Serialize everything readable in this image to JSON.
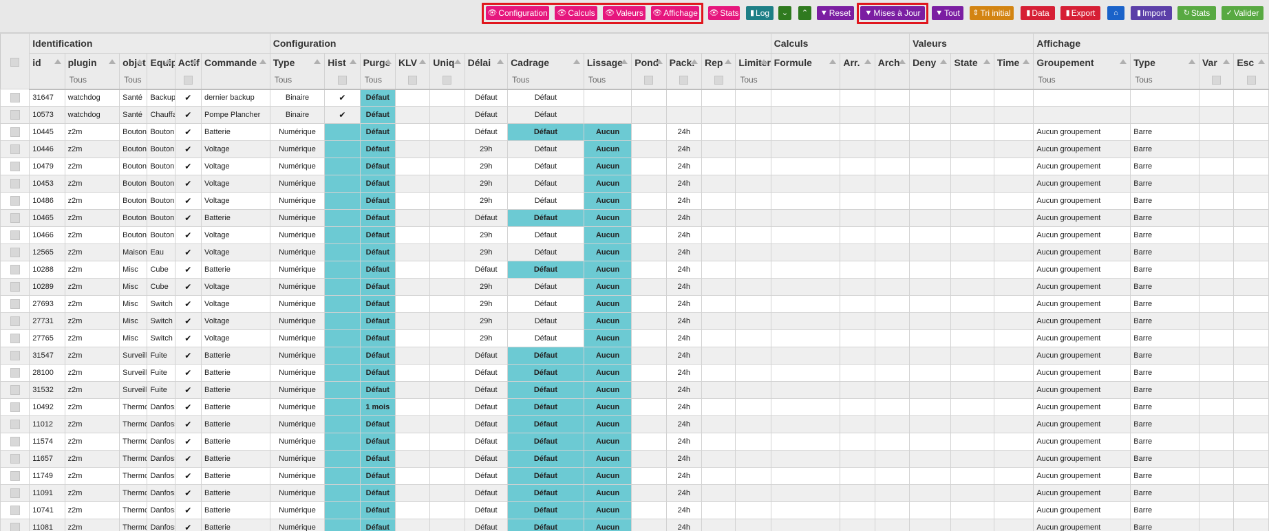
{
  "toolbar": {
    "configuration": "Configuration",
    "calculs": "Calculs",
    "valeurs": "Valeurs",
    "affichage": "Affichage",
    "stats": "Stats",
    "log": "Log",
    "reset": "Reset",
    "mises_a_jour": "Mises à Jour",
    "tout": "Tout",
    "tri_initial": "Tri initial",
    "data": "Data",
    "export": "Export",
    "import": "Import",
    "stats2": "Stats",
    "valider": "Valider"
  },
  "colors": {
    "pink": "#e6167d",
    "teal": "#1d7f86",
    "green_dark": "#2f7a1f",
    "purple": "#7b1ea2",
    "orange": "#d38412",
    "red": "#d61f35",
    "blue": "#1a62c9",
    "indigo": "#5b3fa8",
    "green": "#58a942",
    "highlight": "#e0161d",
    "cell_teal": "#6ccad3"
  },
  "groups": {
    "identification": "Identification",
    "configuration": "Configuration",
    "calculs": "Calculs",
    "valeurs": "Valeurs",
    "affichage": "Affichage"
  },
  "columns": {
    "id": "id",
    "plugin": "plugin",
    "objet": "objet",
    "equip": "Equip",
    "actif": "Actif",
    "commande": "Commande",
    "type": "Type",
    "hist": "Hist",
    "purge": "Purge",
    "klv": "KLV",
    "uniq": "Uniq",
    "delai": "Délai",
    "cadrage": "Cadrage",
    "lissage": "Lissage",
    "pond": "Pond",
    "pack": "Pack.",
    "rep": "Rep",
    "limiter": "Limiter",
    "formule": "Formule",
    "arr": "Arr.",
    "arch": "Arch",
    "deny": "Deny",
    "state": "State",
    "time": "Time",
    "groupement": "Groupement",
    "type2": "Type",
    "var": "Var",
    "esc": "Esc"
  },
  "filters": {
    "tous": "Tous"
  },
  "rows": [
    {
      "id": "31647",
      "plugin": "watchdog",
      "objet": "Santé",
      "equip": "Backup",
      "actif": "✔",
      "commande": "dernier backup",
      "type": "Binaire",
      "hist": "✔",
      "purge": "Défaut",
      "delai": "Défaut",
      "cadrage": "Défaut",
      "lissage": "",
      "pack": "",
      "groupement": "",
      "type2": ""
    },
    {
      "id": "10573",
      "plugin": "watchdog",
      "objet": "Santé",
      "equip": "Chauffage",
      "actif": "✔",
      "commande": "Pompe Plancher",
      "type": "Binaire",
      "hist": "✔",
      "purge": "Défaut",
      "delai": "Défaut",
      "cadrage": "Défaut",
      "lissage": "",
      "pack": "",
      "groupement": "",
      "type2": ""
    },
    {
      "id": "10445",
      "plugin": "z2m",
      "objet": "Bouton",
      "equip": "Bouton",
      "actif": "✔",
      "commande": "Batterie",
      "type": "Numérique",
      "hist": "",
      "purge": "Défaut",
      "delai": "Défaut",
      "cadrage": "Défaut",
      "lissage": "Aucun",
      "pack": "24h",
      "groupement": "Aucun groupement",
      "type2": "Barre"
    },
    {
      "id": "10446",
      "plugin": "z2m",
      "objet": "Bouton",
      "equip": "Bouton",
      "actif": "✔",
      "commande": "Voltage",
      "type": "Numérique",
      "hist": "",
      "purge": "Défaut",
      "delai": "29h",
      "cadrage": "Défaut",
      "lissage": "Aucun",
      "pack": "24h",
      "groupement": "Aucun groupement",
      "type2": "Barre"
    },
    {
      "id": "10479",
      "plugin": "z2m",
      "objet": "Bouton",
      "equip": "Bouton",
      "actif": "✔",
      "commande": "Voltage",
      "type": "Numérique",
      "hist": "",
      "purge": "Défaut",
      "delai": "29h",
      "cadrage": "Défaut",
      "lissage": "Aucun",
      "pack": "24h",
      "groupement": "Aucun groupement",
      "type2": "Barre"
    },
    {
      "id": "10453",
      "plugin": "z2m",
      "objet": "Bouton",
      "equip": "Bouton",
      "actif": "✔",
      "commande": "Voltage",
      "type": "Numérique",
      "hist": "",
      "purge": "Défaut",
      "delai": "29h",
      "cadrage": "Défaut",
      "lissage": "Aucun",
      "pack": "24h",
      "groupement": "Aucun groupement",
      "type2": "Barre"
    },
    {
      "id": "10486",
      "plugin": "z2m",
      "objet": "Bouton",
      "equip": "Bouton",
      "actif": "✔",
      "commande": "Voltage",
      "type": "Numérique",
      "hist": "",
      "purge": "Défaut",
      "delai": "29h",
      "cadrage": "Défaut",
      "lissage": "Aucun",
      "pack": "24h",
      "groupement": "Aucun groupement",
      "type2": "Barre"
    },
    {
      "id": "10465",
      "plugin": "z2m",
      "objet": "Bouton",
      "equip": "Bouton",
      "actif": "✔",
      "commande": "Batterie",
      "type": "Numérique",
      "hist": "",
      "purge": "Défaut",
      "delai": "Défaut",
      "cadrage": "Défaut",
      "lissage": "Aucun",
      "pack": "24h",
      "groupement": "Aucun groupement",
      "type2": "Barre"
    },
    {
      "id": "10466",
      "plugin": "z2m",
      "objet": "Bouton",
      "equip": "Bouton",
      "actif": "✔",
      "commande": "Voltage",
      "type": "Numérique",
      "hist": "",
      "purge": "Défaut",
      "delai": "29h",
      "cadrage": "Défaut",
      "lissage": "Aucun",
      "pack": "24h",
      "groupement": "Aucun groupement",
      "type2": "Barre"
    },
    {
      "id": "12565",
      "plugin": "z2m",
      "objet": "Maison",
      "equip": "Eau",
      "actif": "✔",
      "commande": "Voltage",
      "type": "Numérique",
      "hist": "",
      "purge": "Défaut",
      "delai": "29h",
      "cadrage": "Défaut",
      "lissage": "Aucun",
      "pack": "24h",
      "groupement": "Aucun groupement",
      "type2": "Barre"
    },
    {
      "id": "10288",
      "plugin": "z2m",
      "objet": "Misc",
      "equip": "Cube",
      "actif": "✔",
      "commande": "Batterie",
      "type": "Numérique",
      "hist": "",
      "purge": "Défaut",
      "delai": "Défaut",
      "cadrage": "Défaut",
      "lissage": "Aucun",
      "pack": "24h",
      "groupement": "Aucun groupement",
      "type2": "Barre"
    },
    {
      "id": "10289",
      "plugin": "z2m",
      "objet": "Misc",
      "equip": "Cube",
      "actif": "✔",
      "commande": "Voltage",
      "type": "Numérique",
      "hist": "",
      "purge": "Défaut",
      "delai": "29h",
      "cadrage": "Défaut",
      "lissage": "Aucun",
      "pack": "24h",
      "groupement": "Aucun groupement",
      "type2": "Barre"
    },
    {
      "id": "27693",
      "plugin": "z2m",
      "objet": "Misc",
      "equip": "Switch",
      "actif": "✔",
      "commande": "Voltage",
      "type": "Numérique",
      "hist": "",
      "purge": "Défaut",
      "delai": "29h",
      "cadrage": "Défaut",
      "lissage": "Aucun",
      "pack": "24h",
      "groupement": "Aucun groupement",
      "type2": "Barre"
    },
    {
      "id": "27731",
      "plugin": "z2m",
      "objet": "Misc",
      "equip": "Switch",
      "actif": "✔",
      "commande": "Voltage",
      "type": "Numérique",
      "hist": "",
      "purge": "Défaut",
      "delai": "29h",
      "cadrage": "Défaut",
      "lissage": "Aucun",
      "pack": "24h",
      "groupement": "Aucun groupement",
      "type2": "Barre"
    },
    {
      "id": "27765",
      "plugin": "z2m",
      "objet": "Misc",
      "equip": "Switch",
      "actif": "✔",
      "commande": "Voltage",
      "type": "Numérique",
      "hist": "",
      "purge": "Défaut",
      "delai": "29h",
      "cadrage": "Défaut",
      "lissage": "Aucun",
      "pack": "24h",
      "groupement": "Aucun groupement",
      "type2": "Barre"
    },
    {
      "id": "31547",
      "plugin": "z2m",
      "objet": "Surveillance",
      "equip": "Fuite",
      "actif": "✔",
      "commande": "Batterie",
      "type": "Numérique",
      "hist": "",
      "purge": "Défaut",
      "delai": "Défaut",
      "cadrage": "Défaut",
      "lissage": "Aucun",
      "pack": "24h",
      "groupement": "Aucun groupement",
      "type2": "Barre"
    },
    {
      "id": "28100",
      "plugin": "z2m",
      "objet": "Surveillance",
      "equip": "Fuite",
      "actif": "✔",
      "commande": "Batterie",
      "type": "Numérique",
      "hist": "",
      "purge": "Défaut",
      "delai": "Défaut",
      "cadrage": "Défaut",
      "lissage": "Aucun",
      "pack": "24h",
      "groupement": "Aucun groupement",
      "type2": "Barre"
    },
    {
      "id": "31532",
      "plugin": "z2m",
      "objet": "Surveillance",
      "equip": "Fuite",
      "actif": "✔",
      "commande": "Batterie",
      "type": "Numérique",
      "hist": "",
      "purge": "Défaut",
      "delai": "Défaut",
      "cadrage": "Défaut",
      "lissage": "Aucun",
      "pack": "24h",
      "groupement": "Aucun groupement",
      "type2": "Barre"
    },
    {
      "id": "10492",
      "plugin": "z2m",
      "objet": "Thermostat",
      "equip": "Danfoss",
      "actif": "✔",
      "commande": "Batterie",
      "type": "Numérique",
      "hist": "",
      "purge": "1 mois",
      "delai": "Défaut",
      "cadrage": "Défaut",
      "lissage": "Aucun",
      "pack": "24h",
      "groupement": "Aucun groupement",
      "type2": "Barre"
    },
    {
      "id": "11012",
      "plugin": "z2m",
      "objet": "Thermostat",
      "equip": "Danfoss",
      "actif": "✔",
      "commande": "Batterie",
      "type": "Numérique",
      "hist": "",
      "purge": "Défaut",
      "delai": "Défaut",
      "cadrage": "Défaut",
      "lissage": "Aucun",
      "pack": "24h",
      "groupement": "Aucun groupement",
      "type2": "Barre"
    },
    {
      "id": "11574",
      "plugin": "z2m",
      "objet": "Thermostat",
      "equip": "Danfoss",
      "actif": "✔",
      "commande": "Batterie",
      "type": "Numérique",
      "hist": "",
      "purge": "Défaut",
      "delai": "Défaut",
      "cadrage": "Défaut",
      "lissage": "Aucun",
      "pack": "24h",
      "groupement": "Aucun groupement",
      "type2": "Barre"
    },
    {
      "id": "11657",
      "plugin": "z2m",
      "objet": "Thermostat",
      "equip": "Danfoss",
      "actif": "✔",
      "commande": "Batterie",
      "type": "Numérique",
      "hist": "",
      "purge": "Défaut",
      "delai": "Défaut",
      "cadrage": "Défaut",
      "lissage": "Aucun",
      "pack": "24h",
      "groupement": "Aucun groupement",
      "type2": "Barre"
    },
    {
      "id": "11749",
      "plugin": "z2m",
      "objet": "Thermostat",
      "equip": "Danfoss",
      "actif": "✔",
      "commande": "Batterie",
      "type": "Numérique",
      "hist": "",
      "purge": "Défaut",
      "delai": "Défaut",
      "cadrage": "Défaut",
      "lissage": "Aucun",
      "pack": "24h",
      "groupement": "Aucun groupement",
      "type2": "Barre"
    },
    {
      "id": "11091",
      "plugin": "z2m",
      "objet": "Thermostat",
      "equip": "Danfoss",
      "actif": "✔",
      "commande": "Batterie",
      "type": "Numérique",
      "hist": "",
      "purge": "Défaut",
      "delai": "Défaut",
      "cadrage": "Défaut",
      "lissage": "Aucun",
      "pack": "24h",
      "groupement": "Aucun groupement",
      "type2": "Barre"
    },
    {
      "id": "10741",
      "plugin": "z2m",
      "objet": "Thermostat",
      "equip": "Danfoss",
      "actif": "✔",
      "commande": "Batterie",
      "type": "Numérique",
      "hist": "",
      "purge": "Défaut",
      "delai": "Défaut",
      "cadrage": "Défaut",
      "lissage": "Aucun",
      "pack": "24h",
      "groupement": "Aucun groupement",
      "type2": "Barre"
    },
    {
      "id": "11081",
      "plugin": "z2m",
      "objet": "Thermostat",
      "equip": "Danfoss",
      "actif": "✔",
      "commande": "Batterie",
      "type": "Numérique",
      "hist": "",
      "purge": "Défaut",
      "delai": "Défaut",
      "cadrage": "Défaut",
      "lissage": "Aucun",
      "pack": "24h",
      "groupement": "Aucun groupement",
      "type2": "Barre"
    }
  ]
}
